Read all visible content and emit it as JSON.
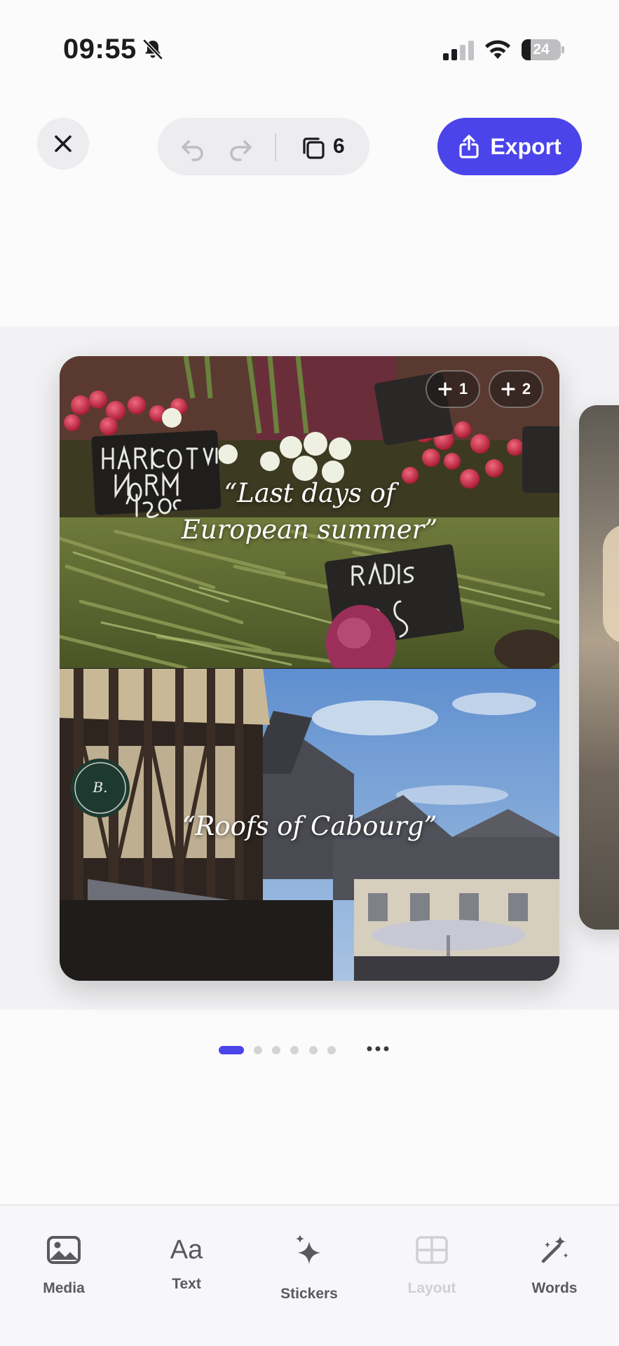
{
  "status_bar": {
    "time": "09:55",
    "battery_percent": "24",
    "battery_level": 0.24,
    "icons": [
      "bell-slash-icon",
      "cellular-signal-icon",
      "wifi-icon",
      "battery-icon"
    ]
  },
  "top_bar": {
    "close_icon": "close-icon",
    "undo_icon": "undo-icon",
    "redo_icon": "redo-icon",
    "pages_icon": "pages-icon",
    "pages_count": "6",
    "export_label": "Export",
    "export_icon": "share-icon"
  },
  "slide": {
    "top_caption_line1": "“Last days of",
    "top_caption_line2": "European summer”",
    "bottom_caption": "“Roofs of Cabourg”",
    "badges": [
      {
        "label": "1",
        "icon": "plus-icon"
      },
      {
        "label": "2",
        "icon": "plus-icon"
      }
    ],
    "photo_top_alt": "market vegetables",
    "photo_bottom_alt": "half-timbered houses"
  },
  "pager": {
    "total": 6,
    "active": 1,
    "more_icon": "ellipsis-icon"
  },
  "toolbar": {
    "items": [
      {
        "label": "Media",
        "icon": "image-icon",
        "disabled": false
      },
      {
        "label": "Text",
        "icon": "text-aa-icon",
        "disabled": false
      },
      {
        "label": "Stickers",
        "icon": "sparkles-icon",
        "disabled": false
      },
      {
        "label": "Layout",
        "icon": "layout-grid-icon",
        "disabled": true
      },
      {
        "label": "Words",
        "icon": "magic-wand-icon",
        "disabled": false
      }
    ],
    "text_icon_glyph": "Aa"
  },
  "colors": {
    "accent": "#4b44ea",
    "background": "#fbfbfc",
    "toolbar_bg": "#f7f7f9",
    "label_gray": "#5a5a5e"
  }
}
